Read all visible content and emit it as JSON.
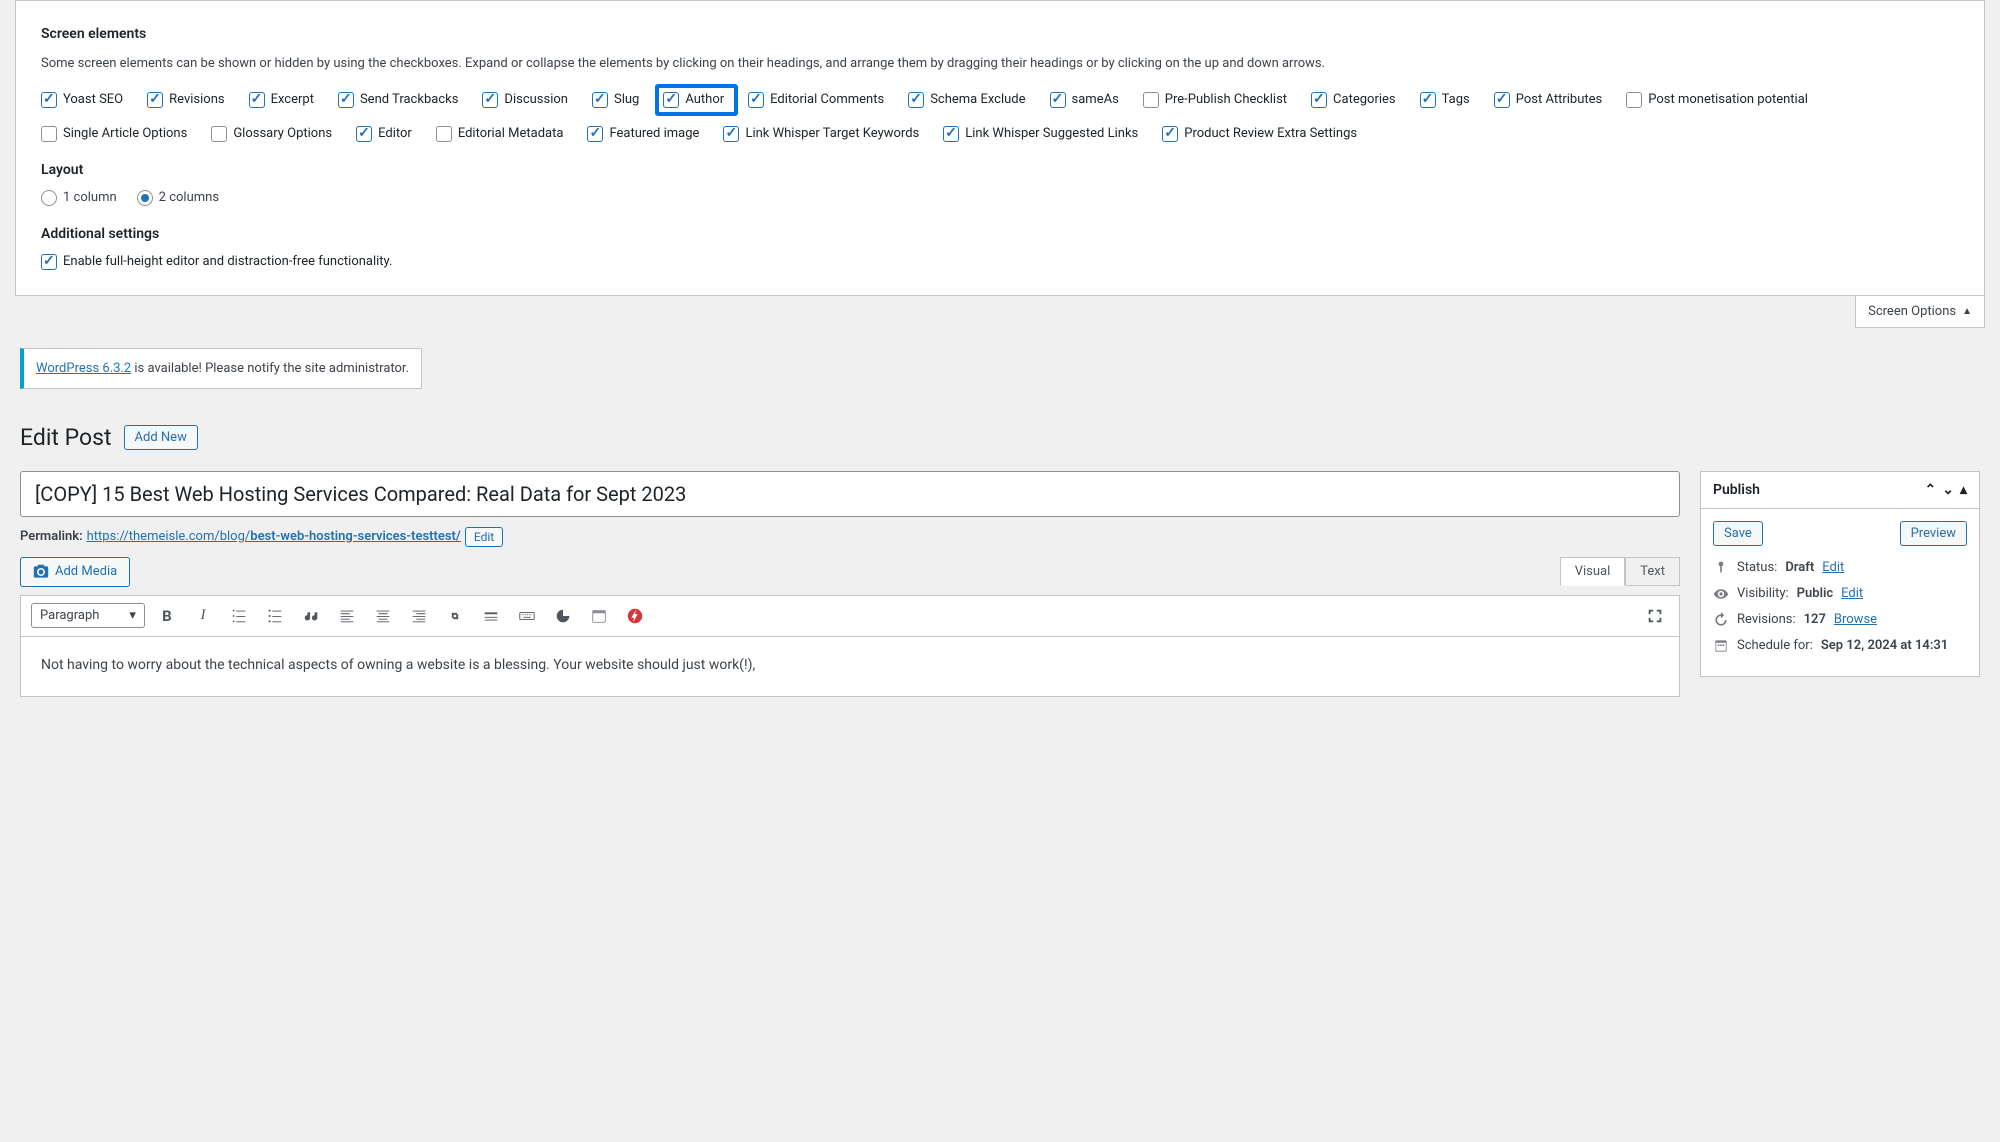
{
  "screenOptions": {
    "heading": "Screen elements",
    "description": "Some screen elements can be shown or hidden by using the checkboxes. Expand or collapse the elements by clicking on their headings, and arrange them by dragging their headings or by clicking on the up and down arrows.",
    "checkboxes": [
      {
        "label": "Yoast SEO",
        "checked": true,
        "highlighted": false
      },
      {
        "label": "Revisions",
        "checked": true,
        "highlighted": false
      },
      {
        "label": "Excerpt",
        "checked": true,
        "highlighted": false
      },
      {
        "label": "Send Trackbacks",
        "checked": true,
        "highlighted": false
      },
      {
        "label": "Discussion",
        "checked": true,
        "highlighted": false
      },
      {
        "label": "Slug",
        "checked": true,
        "highlighted": false
      },
      {
        "label": "Author",
        "checked": true,
        "highlighted": true
      },
      {
        "label": "Editorial Comments",
        "checked": true,
        "highlighted": false
      },
      {
        "label": "Schema Exclude",
        "checked": true,
        "highlighted": false
      },
      {
        "label": "sameAs",
        "checked": true,
        "highlighted": false
      },
      {
        "label": "Pre-Publish Checklist",
        "checked": false,
        "highlighted": false
      },
      {
        "label": "Categories",
        "checked": true,
        "highlighted": false
      },
      {
        "label": "Tags",
        "checked": true,
        "highlighted": false
      },
      {
        "label": "Post Attributes",
        "checked": true,
        "highlighted": false
      },
      {
        "label": "Post monetisation potential",
        "checked": false,
        "highlighted": false
      },
      {
        "label": "Single Article Options",
        "checked": false,
        "highlighted": false
      },
      {
        "label": "Glossary Options",
        "checked": false,
        "highlighted": false
      },
      {
        "label": "Editor",
        "checked": true,
        "highlighted": false
      },
      {
        "label": "Editorial Metadata",
        "checked": false,
        "highlighted": false
      },
      {
        "label": "Featured image",
        "checked": true,
        "highlighted": false
      },
      {
        "label": "Link Whisper Target Keywords",
        "checked": true,
        "highlighted": false
      },
      {
        "label": "Link Whisper Suggested Links",
        "checked": true,
        "highlighted": false
      },
      {
        "label": "Product Review Extra Settings",
        "checked": true,
        "highlighted": false
      }
    ],
    "layoutHeading": "Layout",
    "layoutOptions": [
      {
        "label": "1 column",
        "checked": false
      },
      {
        "label": "2 columns",
        "checked": true
      }
    ],
    "additionalHeading": "Additional settings",
    "additionalCheckbox": {
      "label": "Enable full-height editor and distraction-free functionality.",
      "checked": true
    },
    "toggleLabel": "Screen Options"
  },
  "notice": {
    "linkText": "WordPress 6.3.2",
    "text": " is available! Please notify the site administrator."
  },
  "pageTitle": "Edit Post",
  "addNewLabel": "Add New",
  "postTitle": "[COPY] 15 Best Web Hosting Services Compared: Real Data for Sept 2023",
  "permalink": {
    "label": "Permalink:",
    "base": "https://themeisle.com/blog/",
    "slug": "best-web-hosting-services-testtest/",
    "editLabel": "Edit"
  },
  "addMediaLabel": "Add Media",
  "editorTabs": {
    "visual": "Visual",
    "text": "Text"
  },
  "toolbarFormat": "Paragraph",
  "editorContent": "Not having to worry about the technical aspects of owning a website is a blessing. Your website should just work(!),",
  "publishBox": {
    "title": "Publish",
    "saveLabel": "Save",
    "previewLabel": "Preview",
    "statusLabel": "Status:",
    "statusValue": "Draft",
    "editLabel": "Edit",
    "visibilityLabel": "Visibility:",
    "visibilityValue": "Public",
    "revisionsLabel": "Revisions:",
    "revisionsCount": "127",
    "browseLabel": "Browse",
    "scheduleLabel": "Schedule for:",
    "scheduleValue": "Sep 12, 2024 at 14:31"
  }
}
